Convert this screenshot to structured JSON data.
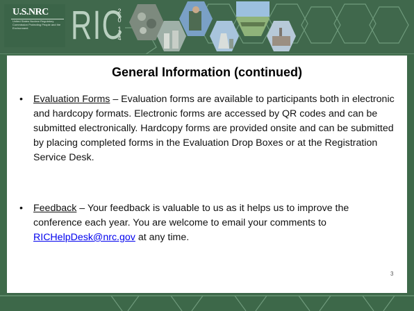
{
  "logo": {
    "name": "U.S.NRC",
    "tagline": "United States Nuclear Regulatory Commission Protecting People and the Environment"
  },
  "conference": {
    "name": "RIC",
    "year_digits": [
      "2",
      "0",
      "1",
      "4"
    ]
  },
  "slide": {
    "title": "General Information (continued)",
    "page_number": "3",
    "bullets": [
      {
        "term": "Evaluation Forms",
        "text": " – Evaluation forms are available to participants both in electronic and hardcopy formats. Electronic forms are accessed by QR codes and can be submitted electronically.  Hardcopy forms are provided onsite and can be submitted by placing completed forms in the Evaluation Drop Boxes or at the Registration Service Desk."
      },
      {
        "term": "Feedback",
        "text_before": " – Your feedback is valuable to us as it helps us to improve the conference each year.  You are welcome to email your comments to ",
        "email": "RICHelpDesk@nrc.gov",
        "text_after": " at any time."
      }
    ]
  },
  "colors": {
    "band": "#40684c",
    "hex_outline": "#6f9a7c",
    "content_bg": "#ffffff",
    "link": "#0000ee"
  }
}
